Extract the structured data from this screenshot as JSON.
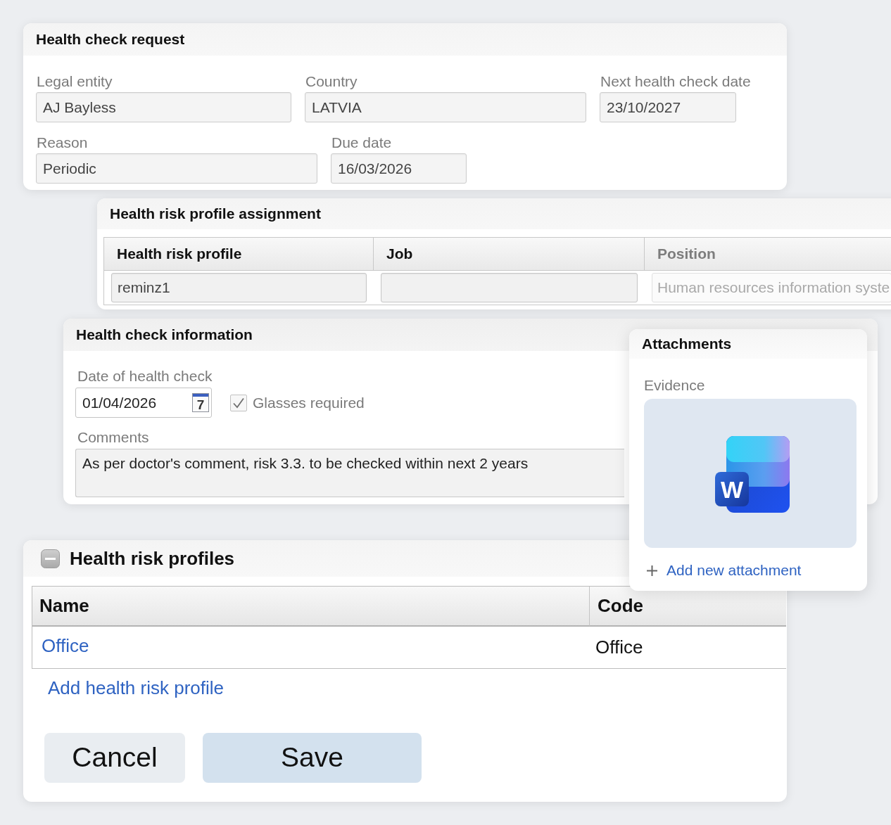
{
  "health_check_request": {
    "title": "Health check request",
    "rows": [
      [
        {
          "label": "Legal entity",
          "value": "AJ Bayless"
        },
        {
          "label": "Country",
          "value": "LATVIA"
        },
        {
          "label": "Next health check date",
          "value": "23/10/2027"
        }
      ],
      [
        {
          "label": "Reason",
          "value": "Periodic"
        },
        {
          "label": "Due date",
          "value": "16/03/2026"
        }
      ]
    ]
  },
  "health_risk_profile_assignment": {
    "title": "Health risk profile assignment",
    "columns": [
      {
        "label": "Health risk profile",
        "disabled": false
      },
      {
        "label": "Job",
        "disabled": false
      },
      {
        "label": "Position",
        "disabled": true
      }
    ],
    "rows": [
      {
        "cells": [
          {
            "value": "reminz1",
            "disabled": false
          },
          {
            "disabled": false
          },
          {
            "value": "Human resources information syste",
            "disabled": true
          }
        ]
      }
    ]
  },
  "health_check_information": {
    "title": "Health check information",
    "date_field": {
      "label": "Date of health check",
      "value": "01/04/2026",
      "calendar_day": "7"
    },
    "checkbox": {
      "label": "Glasses required",
      "checked": true,
      "disabled": true
    },
    "comments": {
      "label": "Comments",
      "value": "As per doctor's comment, risk 3.3. to be checked within next 2 years"
    }
  },
  "attachments": {
    "title": "Attachments",
    "label": "Evidence",
    "file": {
      "icon_letter": "W"
    },
    "add_link": "Add new attachment"
  },
  "health_risk_profiles": {
    "title": "Health risk profiles",
    "expanded": true,
    "columns": [
      {
        "label": "Name"
      },
      {
        "label": "Code"
      }
    ],
    "rows": [
      {
        "name": "Office",
        "code": "Office"
      }
    ],
    "add_link": "Add health risk profile"
  },
  "buttons": [
    {
      "label": "Cancel",
      "kind": "secondary"
    },
    {
      "label": "Save",
      "kind": "primary"
    }
  ]
}
